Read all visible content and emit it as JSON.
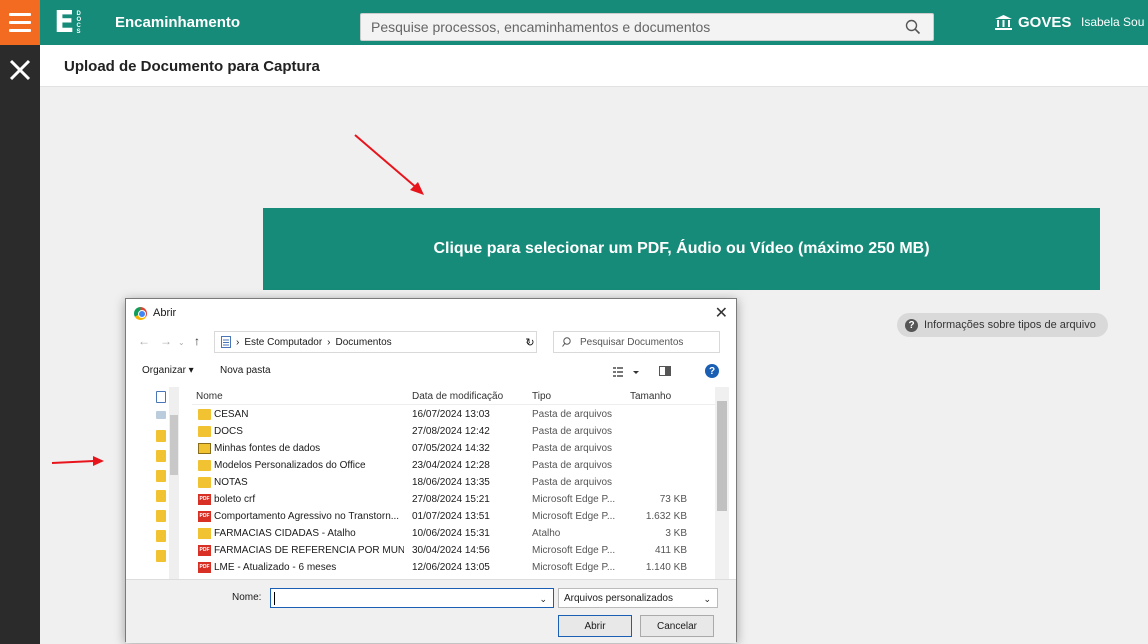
{
  "header": {
    "logo_letter": "E",
    "logo_sub": [
      "D",
      "O",
      "C",
      "S"
    ],
    "app_title": "Encaminhamento",
    "search_placeholder": "Pesquise processos, encaminhamentos e documentos",
    "org": "GOVES",
    "user": "Isabela Sou"
  },
  "page": {
    "title": "Upload de Documento para Captura",
    "upload_label": "Clique para selecionar um PDF, Áudio ou Vídeo (máximo 250 MB)",
    "info_label": "Informações sobre tipos de arquivo"
  },
  "dialog": {
    "title": "Abrir",
    "path": [
      "Este Computador",
      "Documentos"
    ],
    "search_placeholder": "Pesquisar Documentos",
    "organize": "Organizar",
    "new_folder": "Nova pasta",
    "columns": {
      "name": "Nome",
      "date": "Data de modificação",
      "type": "Tipo",
      "size": "Tamanho"
    },
    "files": [
      {
        "icon": "folder",
        "name": "CESAN",
        "date": "16/07/2024 13:03",
        "type": "Pasta de arquivos",
        "size": ""
      },
      {
        "icon": "folder",
        "name": "DOCS",
        "date": "27/08/2024 12:42",
        "type": "Pasta de arquivos",
        "size": ""
      },
      {
        "icon": "db",
        "name": "Minhas fontes de dados",
        "date": "07/05/2024 14:32",
        "type": "Pasta de arquivos",
        "size": ""
      },
      {
        "icon": "folder",
        "name": "Modelos Personalizados do Office",
        "date": "23/04/2024 12:28",
        "type": "Pasta de arquivos",
        "size": ""
      },
      {
        "icon": "folder",
        "name": "NOTAS",
        "date": "18/06/2024 13:35",
        "type": "Pasta de arquivos",
        "size": ""
      },
      {
        "icon": "pdf",
        "name": "boleto crf",
        "date": "27/08/2024 15:21",
        "type": "Microsoft Edge P...",
        "size": "73 KB"
      },
      {
        "icon": "pdf",
        "name": "Comportamento Agressivo no Transtorn...",
        "date": "01/07/2024 13:51",
        "type": "Microsoft Edge P...",
        "size": "1.632 KB"
      },
      {
        "icon": "link",
        "name": "FARMACIAS CIDADAS - Atalho",
        "date": "10/06/2024 15:31",
        "type": "Atalho",
        "size": "3 KB"
      },
      {
        "icon": "pdf",
        "name": "FARMÁCIAS DE REFERENCIA POR MUNI...",
        "date": "30/04/2024 14:56",
        "type": "Microsoft Edge P...",
        "size": "411 KB"
      },
      {
        "icon": "pdf",
        "name": "LME - Atualizado - 6 meses",
        "date": "12/06/2024 13:05",
        "type": "Microsoft Edge P...",
        "size": "1.140 KB"
      }
    ],
    "filename_label": "Nome:",
    "filename_value": "",
    "filetype": "Arquivos personalizados",
    "open_button": "Abrir",
    "cancel_button": "Cancelar"
  },
  "colors": {
    "brand": "#168b79",
    "accent": "#f26b21",
    "rail": "#2b2b2b",
    "annotation": "#e8141c"
  },
  "icons": [
    "hamburger-icon",
    "close-icon",
    "search-icon",
    "bank-icon",
    "info-icon",
    "chrome-icon",
    "refresh-icon",
    "help-icon"
  ]
}
